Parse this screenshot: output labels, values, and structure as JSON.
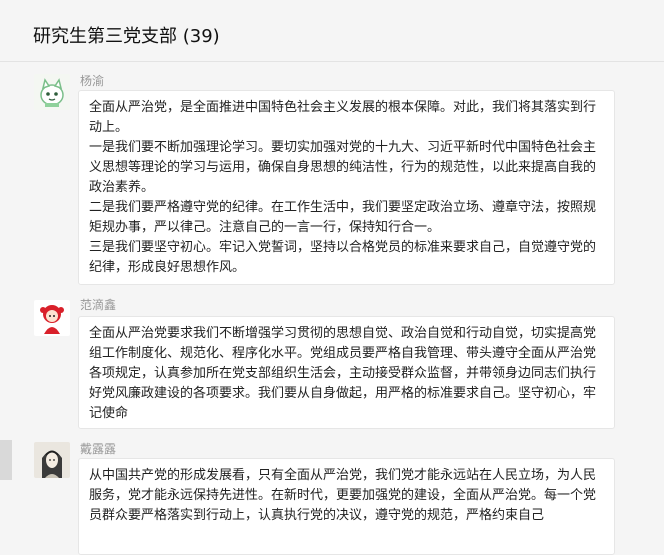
{
  "chat": {
    "title": "研究生第三党支部 (39)",
    "messages": [
      {
        "sender": "杨渝",
        "avatar_icon": "cartoon-cat-avatar",
        "text": "全面从严治党，是全面推进中国特色社会主义发展的根本保障。对此，我们将其落实到行动上。\n一是我们要不断加强理论学习。要切实加强对党的十九大、习近平新时代中国特色社会主义思想等理论的学习与运用，确保自身思想的纯洁性，行为的规范性，以此来提高自我的政治素养。\n二是我们要严格遵守党的纪律。在工作生活中，我们要坚定政治立场、遵章守法，按照规矩规办事，严以律己。注意自己的一言一行，保持知行合一。\n三是我们要坚守初心。牢记入党誓词，坚持以合格党员的标准来要求自己，自觉遵守党的纪律，形成良好思想作风。"
      },
      {
        "sender": "范滴鑫",
        "avatar_icon": "red-cartoon-girl-avatar",
        "text": "全面从严治党要求我们不断增强学习贯彻的思想自觉、政治自觉和行动自觉，切实提高党组工作制度化、规范化、程序化水平。党组成员要严格自我管理、带头遵守全面从严治党各项规定，认真参加所在党支部组织生活会，主动接受群众监督，并带领身边同志们执行好党风廉政建设的各项要求。我们要从自身做起，用严格的标准要求自己。坚守初心，牢记使命"
      },
      {
        "sender": "戴露露",
        "avatar_icon": "ink-portrait-avatar",
        "text": "从中国共产党的形成发展看，只有全面从严治党，我们党才能永远站在人民立场，为人民服务，党才能永远保持先进性。在新时代，更要加强党的建设，全面从严治党。每一个党员群众要严格落实到行动上，认真执行党的决议，遵守党的规范，严格约束自己"
      }
    ]
  },
  "colors": {
    "background": "#f5f5f5",
    "bubble": "#ffffff",
    "sender_text": "#999999"
  }
}
